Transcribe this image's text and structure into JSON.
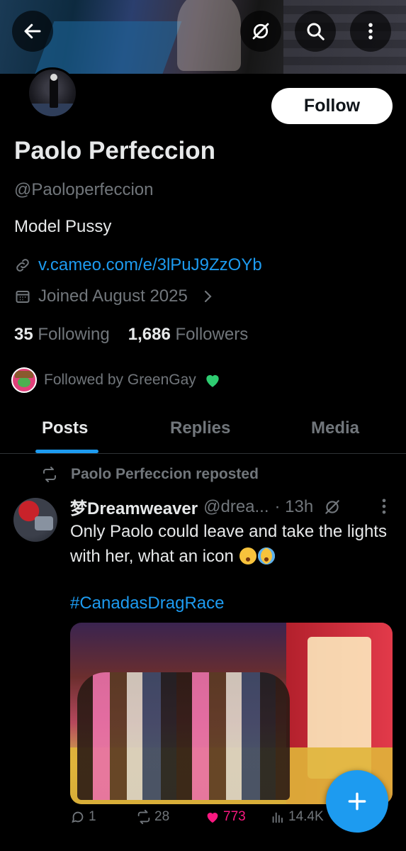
{
  "profile": {
    "name": "Paolo Perfeccion",
    "handle": "@Paoloperfeccion",
    "bio": "Model Pussy",
    "link": "v.cameo.com/e/3lPuJ9ZzOYb",
    "joined": "Joined August 2025",
    "following_count": "35",
    "following_label": "Following",
    "followers_count": "1,686",
    "followers_label": "Followers",
    "followed_by": "Followed by GreenGay",
    "follow_label": "Follow"
  },
  "tabs": [
    {
      "label": "Posts"
    },
    {
      "label": "Replies"
    },
    {
      "label": "Media"
    }
  ],
  "post": {
    "repost_label": "Paolo Perfeccion reposted",
    "author_name": "梦Dreamweaver",
    "author_handle": "@drea...",
    "time": "· 13h",
    "text": "Only Paolo could leave and take the lights with her, what an icon",
    "hashtag": "#CanadasDragRace",
    "replies": "1",
    "reposts": "28",
    "likes": "773",
    "views": "14.4K"
  },
  "icons": {
    "back": "arrow-left-icon",
    "grok": "grok-icon",
    "search": "search-icon",
    "more": "more-vertical-icon",
    "link": "link-icon",
    "calendar": "calendar-icon",
    "chevron": "chevron-right-icon",
    "heart": "green-heart-icon",
    "repost": "repost-icon",
    "reply": "reply-icon",
    "like": "heart-icon",
    "views": "views-icon",
    "compose": "plus-icon"
  },
  "colors": {
    "accent": "#1d9bf0",
    "like": "#f91880",
    "muted": "#71767b",
    "text": "#e7e9ea",
    "background": "#000000"
  }
}
